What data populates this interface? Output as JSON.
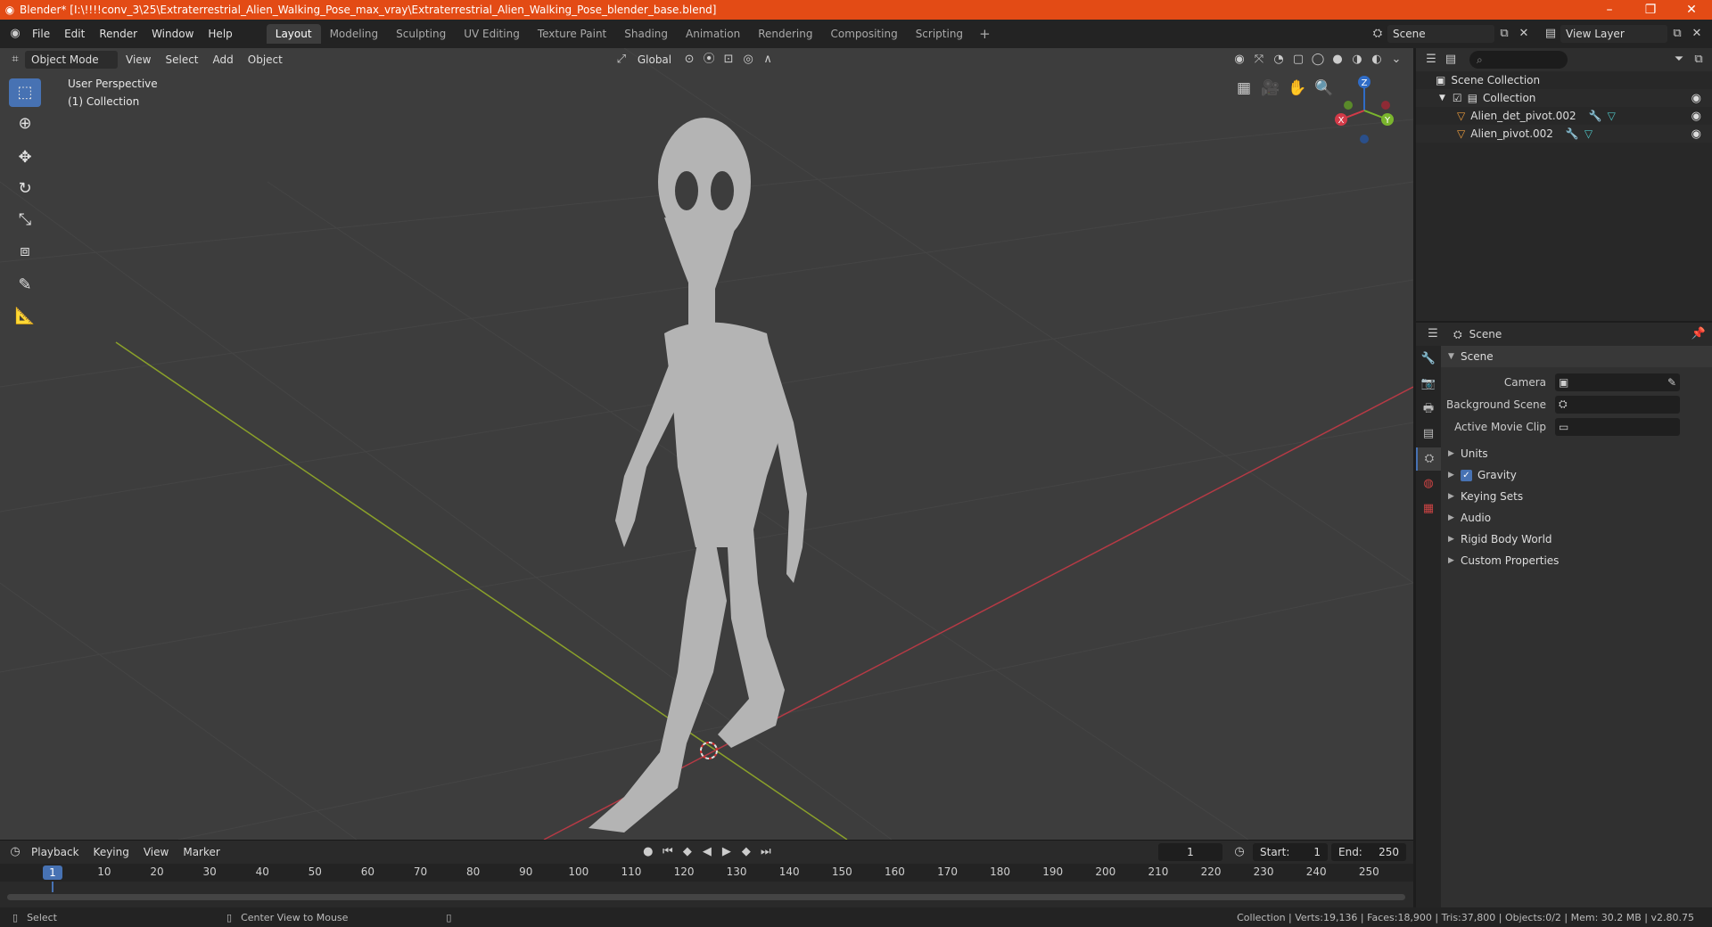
{
  "window": {
    "title": "Blender* [I:\\!!!!conv_3\\25\\Extraterrestrial_Alien_Walking_Pose_max_vray\\Extraterrestrial_Alien_Walking_Pose_blender_base.blend]",
    "accent": "#e34b15"
  },
  "menus": [
    "File",
    "Edit",
    "Render",
    "Window",
    "Help"
  ],
  "workspaces": [
    "Layout",
    "Modeling",
    "Sculpting",
    "UV Editing",
    "Texture Paint",
    "Shading",
    "Animation",
    "Rendering",
    "Compositing",
    "Scripting"
  ],
  "scene_name": "Scene",
  "view_layer": "View Layer",
  "viewport": {
    "mode": "Object Mode",
    "menus": [
      "View",
      "Select",
      "Add",
      "Object"
    ],
    "orientation": "Global",
    "perspective": "User Perspective",
    "collection": "(1) Collection",
    "gizmo": {
      "x": "X",
      "y": "Y",
      "z": "Z"
    }
  },
  "timeline": {
    "menus": [
      "Playback",
      "Keying",
      "View",
      "Marker"
    ],
    "current_frame": "1",
    "start_label": "Start:",
    "start": "1",
    "end_label": "End:",
    "end": "250",
    "ticks": [
      "10",
      "20",
      "30",
      "40",
      "50",
      "60",
      "70",
      "80",
      "90",
      "100",
      "110",
      "120",
      "130",
      "140",
      "150",
      "160",
      "170",
      "180",
      "190",
      "200",
      "210",
      "220",
      "230",
      "240",
      "250"
    ],
    "playhead": "1"
  },
  "statusbar": {
    "select": "Select",
    "center": "Center View to Mouse",
    "stats": "Collection | Verts:19,136 | Faces:18,900 | Tris:37,800 | Objects:0/2 | Mem: 30.2 MB | v2.80.75"
  },
  "outliner": {
    "root": "Scene Collection",
    "collection": "Collection",
    "objects": [
      "Alien_det_pivot.002",
      "Alien_pivot.002"
    ]
  },
  "properties": {
    "context": "Scene",
    "panel_title": "Scene",
    "fields": [
      {
        "label": "Camera"
      },
      {
        "label": "Background Scene"
      },
      {
        "label": "Active Movie Clip"
      }
    ],
    "panels": [
      "Units",
      "Gravity",
      "Keying Sets",
      "Audio",
      "Rigid Body World",
      "Custom Properties"
    ]
  }
}
